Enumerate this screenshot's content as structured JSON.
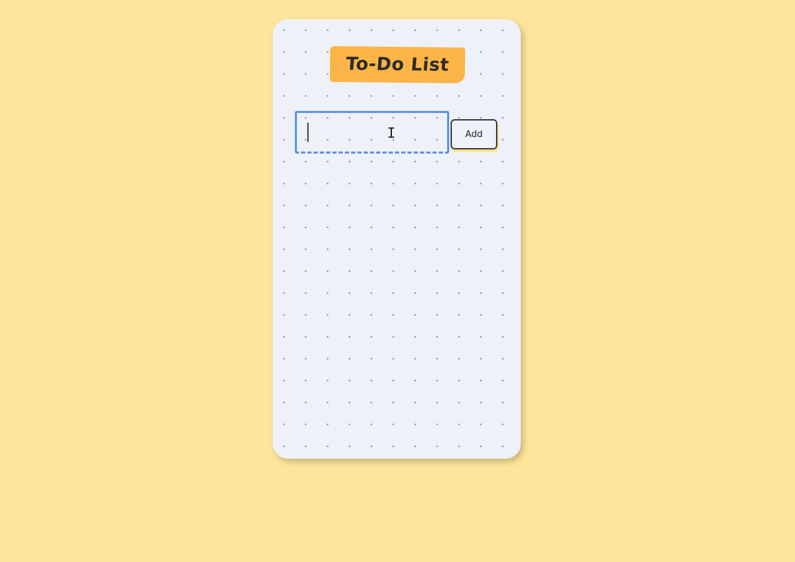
{
  "app": {
    "title": "To-Do List"
  },
  "input": {
    "value": "",
    "placeholder": ""
  },
  "add_button": {
    "label": "Add"
  },
  "tasks": [],
  "colors": {
    "background": "#fde59b",
    "card": "#eef1f7",
    "title_highlight": "#fbb547",
    "input_focus_border": "#5b92e5",
    "button_border": "#3a3d44"
  },
  "icons": {
    "cursor": "text-cursor-ibeam-icon"
  }
}
